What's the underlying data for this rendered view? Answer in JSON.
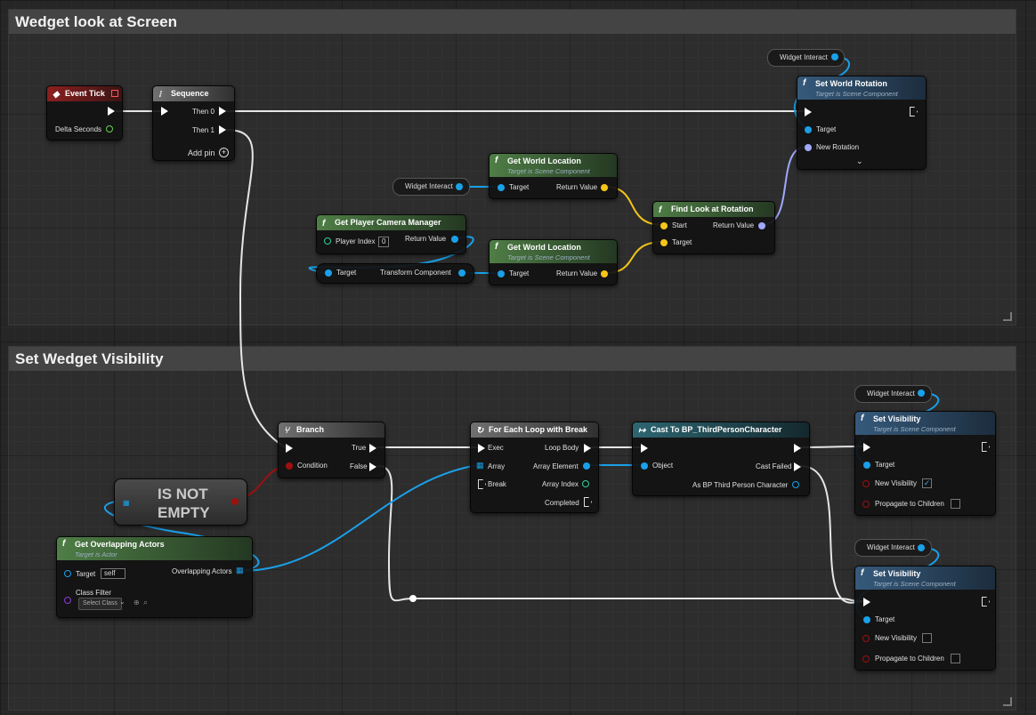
{
  "comments": {
    "top": {
      "title": "Wedget look at Screen"
    },
    "bottom": {
      "title": "Set Wedget Visibility"
    }
  },
  "nodes": {
    "event_tick": {
      "title": "Event Tick",
      "delta_seconds": "Delta Seconds"
    },
    "sequence": {
      "title": "Sequence",
      "then0": "Then 0",
      "then1": "Then 1",
      "add_pin": "Add pin"
    },
    "set_world_rotation": {
      "title": "Set World Rotation",
      "subtitle": "Target is Scene Component",
      "target": "Target",
      "new_rotation": "New Rotation"
    },
    "get_world_location_1": {
      "title": "Get World Location",
      "subtitle": "Target is Scene Component",
      "target": "Target",
      "return_value": "Return Value"
    },
    "get_world_location_2": {
      "title": "Get World Location",
      "subtitle": "Target is Scene Component",
      "target": "Target",
      "return_value": "Return Value"
    },
    "get_player_camera_manager": {
      "title": "Get Player Camera Manager",
      "player_index": "Player Index",
      "player_index_value": "0",
      "return_value": "Return Value"
    },
    "transform_component": {
      "target": "Target",
      "output": "Transform Component"
    },
    "find_look_at_rotation": {
      "title": "Find Look at Rotation",
      "start": "Start",
      "target": "Target",
      "return_value": "Return Value"
    },
    "branch": {
      "title": "Branch",
      "condition": "Condition",
      "true": "True",
      "false": "False"
    },
    "is_not_empty": {
      "label_line1": "IS NOT",
      "label_line2": "EMPTY"
    },
    "get_overlapping_actors": {
      "title": "Get Overlapping Actors",
      "subtitle": "Target is Actor",
      "target": "Target",
      "target_value": "self",
      "overlapping_actors": "Overlapping Actors",
      "class_filter": "Class Filter",
      "select_class": "Select Class"
    },
    "for_each": {
      "title": "For Each Loop with Break",
      "exec": "Exec",
      "array": "Array",
      "break": "Break",
      "loop_body": "Loop Body",
      "array_element": "Array Element",
      "array_index": "Array Index",
      "completed": "Completed"
    },
    "cast": {
      "title": "Cast To BP_ThirdPersonCharacter",
      "object": "Object",
      "cast_failed": "Cast Failed",
      "as_bp": "As BP Third Person Character"
    },
    "set_visibility_1": {
      "title": "Set Visibility",
      "subtitle": "Target is Scene Component",
      "target": "Target",
      "new_visibility": "New Visibility",
      "propagate": "Propagate to Children",
      "new_visibility_checked": true
    },
    "set_visibility_2": {
      "title": "Set Visibility",
      "subtitle": "Target is Scene Component",
      "target": "Target",
      "new_visibility": "New Visibility",
      "propagate": "Propagate to Children",
      "new_visibility_checked": false
    }
  },
  "variables": {
    "widget_interact_1": "Widget Interact",
    "widget_interact_2": "Widget Interact",
    "widget_interact_3": "Widget Interact",
    "widget_interact_4": "Widget Interact"
  },
  "colors": {
    "exec": "#ffffff",
    "object": "#1aa0e8",
    "vector": "#f5c518",
    "rotator": "#a0a8ff",
    "bool": "#9e1010",
    "float": "#6ad04a",
    "int": "#2fd3a0"
  }
}
